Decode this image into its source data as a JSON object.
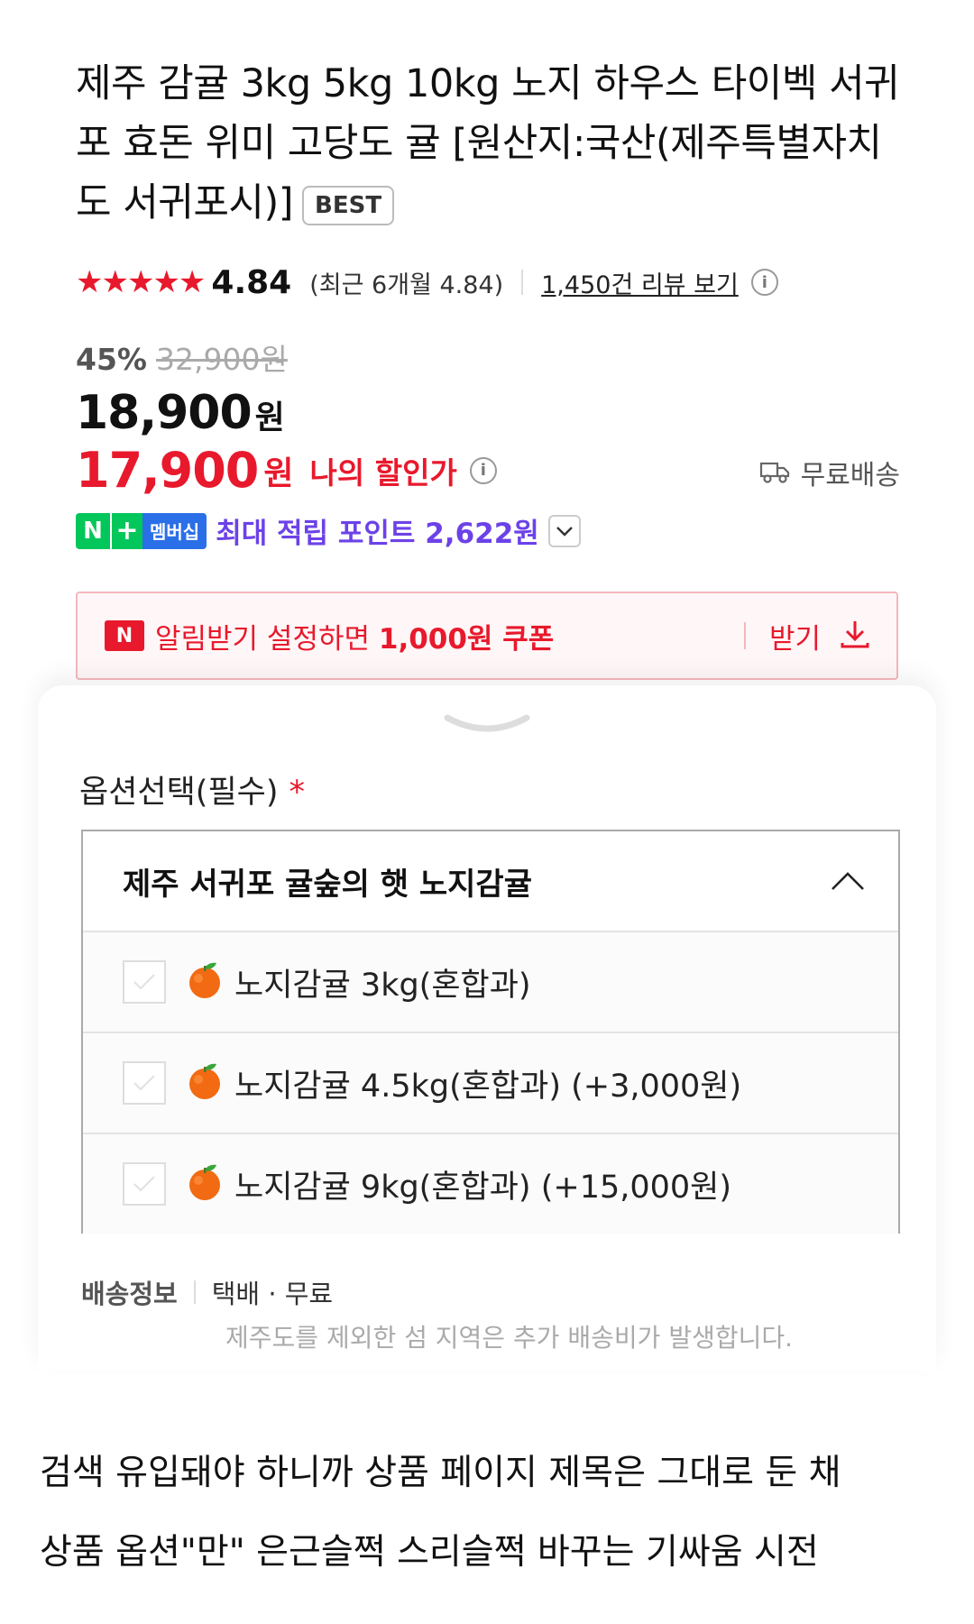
{
  "product": {
    "title": "제주 감귤 3kg 5kg 10kg 노지 하우스 타이벡 서귀포 효돈 위미 고당도 귤 [원산지:국산(제주특별자치도 서귀포시)]",
    "badge": "BEST"
  },
  "rating": {
    "stars": "★★★★★",
    "score": "4.84",
    "recent": "(최근 6개월 4.84)",
    "reviews_link": "1,450건 리뷰 보기",
    "info_icon": "info-icon"
  },
  "price": {
    "discount_pct": "45%",
    "original": "32,900원",
    "sale_value": "18,900",
    "sale_unit": "원",
    "my_price_value": "17,900",
    "my_price_unit": "원",
    "my_price_label": "나의 할인가",
    "free_shipping": "무료배송"
  },
  "points": {
    "n_letter": "N",
    "plus": "+",
    "membership": "멤버십",
    "text": "최대 적립 포인트 2,622원"
  },
  "coupon": {
    "icon_letter": "N",
    "text_prefix": "알림받기 설정하면 ",
    "text_bold": "1,000원 쿠폰",
    "receive": "받기"
  },
  "options": {
    "label": "옵션선택(필수)",
    "required_mark": "*",
    "group_title": "제주 서귀포 귤숲의 햇 노지감귤",
    "items": [
      {
        "label": "노지감귤 3kg(혼합과)"
      },
      {
        "label": "노지감귤 4.5kg(혼합과) (+3,000원)"
      },
      {
        "label": "노지감귤 9kg(혼합과) (+15,000원)"
      }
    ]
  },
  "shipping": {
    "label": "배송정보",
    "value": "택배 · 무료",
    "note": "제주도를 제외한 섬 지역은 추가 배송비가 발생합니다."
  },
  "caption": {
    "line1": "검색 유입돼야 하니까 상품 페이지 제목은 그대로 둔 채",
    "line2": "상품 옵션\"만\" 은근슬쩍 스리슬쩍 바꾸는 기싸움 시전"
  },
  "colors": {
    "accent_red": "#e8192c",
    "naver_green": "#03c75a",
    "membership_blue": "#2b6fe8",
    "points_purple": "#6c42e8"
  }
}
